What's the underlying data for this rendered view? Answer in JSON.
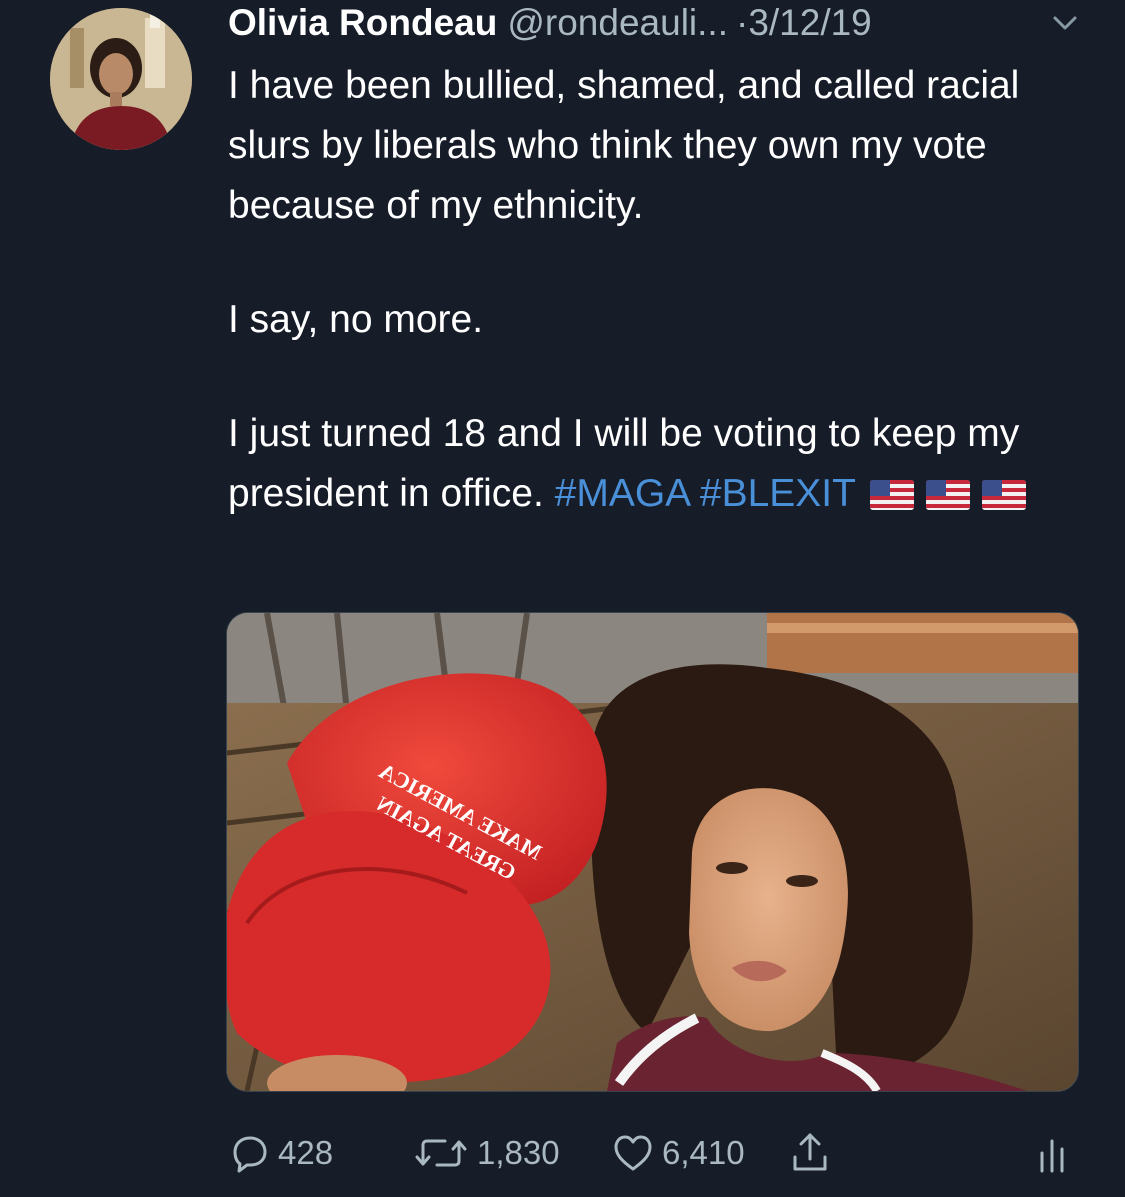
{
  "tweet": {
    "author_name": "Olivia Rondeau",
    "author_handle": "@rondeauli...",
    "separator": "·",
    "date": "3/12/19",
    "body": {
      "paragraph1": "I have been bullied, shamed, and called racial slurs by liberals who think they own my vote because of my ethnicity.",
      "paragraph2": "I say, no more.",
      "paragraph3_text": "I just turned 18 and I will be voting to keep my president in office.",
      "hashtag1": "#MAGA",
      "hashtag2": "#BLEXIT"
    },
    "media": {
      "hat_line1": "MAKE AMERICA",
      "hat_line2": "GREAT AGAIN"
    },
    "actions": {
      "reply_count": "428",
      "retweet_count": "1,830",
      "like_count": "6,410"
    },
    "icons": [
      "chevron-down-icon",
      "flag-us-icon",
      "reply-icon",
      "retweet-icon",
      "heart-icon",
      "share-icon",
      "analytics-icon"
    ],
    "colors": {
      "background": "#161c28",
      "hashtag": "#4a90d9",
      "secondary_text": "#aab8c2",
      "hat_red": "#d9282a"
    }
  }
}
